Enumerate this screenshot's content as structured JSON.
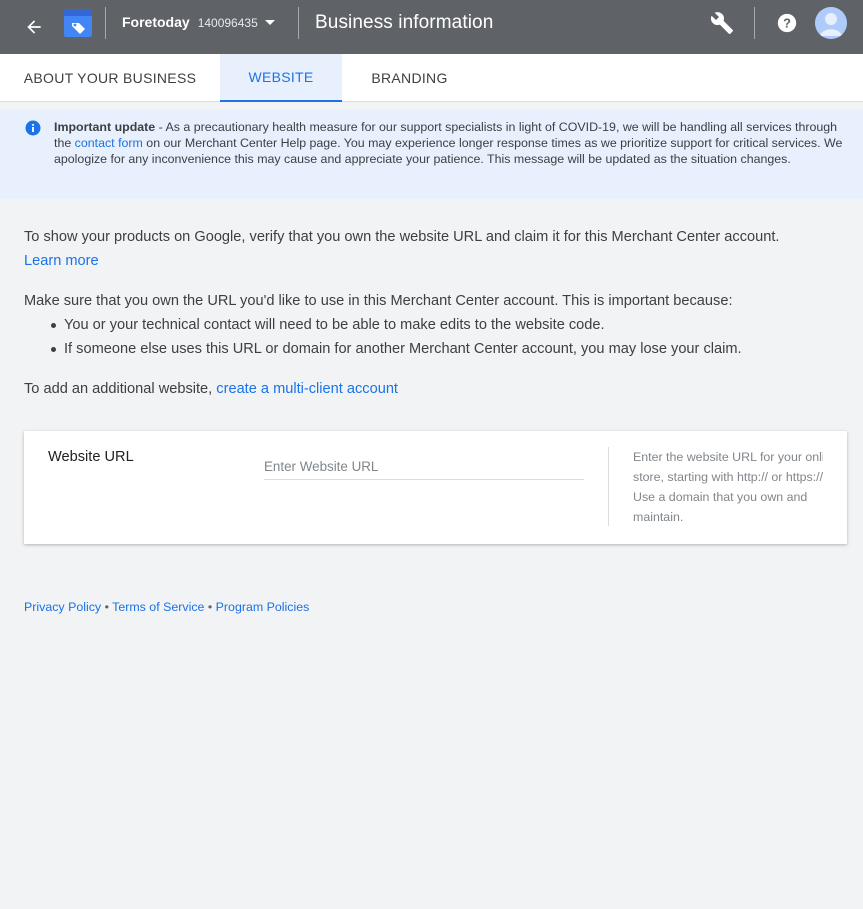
{
  "header": {
    "account_name": "Foretoday",
    "account_id": "140096435",
    "title": "Business information"
  },
  "tabs": [
    {
      "label": "ABOUT YOUR BUSINESS",
      "active": false
    },
    {
      "label": "WEBSITE",
      "active": true
    },
    {
      "label": "BRANDING",
      "active": false
    }
  ],
  "banner": {
    "bold": "Important update",
    "text_before_link": " - As a precautionary health measure for our support specialists in light of COVID-19, we will be handling all services through the ",
    "link": "contact form",
    "text_after_link": " on our Merchant Center Help page. You may experience longer response times as we prioritize support for critical services. We apologize for any inconvenience this may cause and appreciate your patience. This message will be updated as the situation changes."
  },
  "main": {
    "intro": "To show your products on Google, verify that you own the website URL and claim it for this Merchant Center account.",
    "learn_more": "Learn more",
    "ownership_heading": "Make sure that you own the URL you'd like to use in this Merchant Center account. This is important because:",
    "bullets": [
      "You or your technical contact will need to be able to make edits to the website code.",
      "If someone else uses this URL or domain for another Merchant Center account, you may lose your claim."
    ],
    "additional_text": "To add an additional website, ",
    "additional_link": "create a multi-client account"
  },
  "website_card": {
    "label": "Website URL",
    "placeholder": "Enter Website URL",
    "value": "",
    "hint": "Enter the website URL for your online\nstore, starting with http:// or https://.\nUse a domain that you own and\nmaintain."
  },
  "footer": {
    "links": [
      "Privacy Policy",
      "Terms of Service",
      "Program Policies"
    ],
    "separator": "•"
  },
  "colors": {
    "topbar": "#5f6368",
    "accent": "#1a73e8",
    "banner_bg": "#e8f0fe",
    "page_bg": "#f1f3f4"
  }
}
